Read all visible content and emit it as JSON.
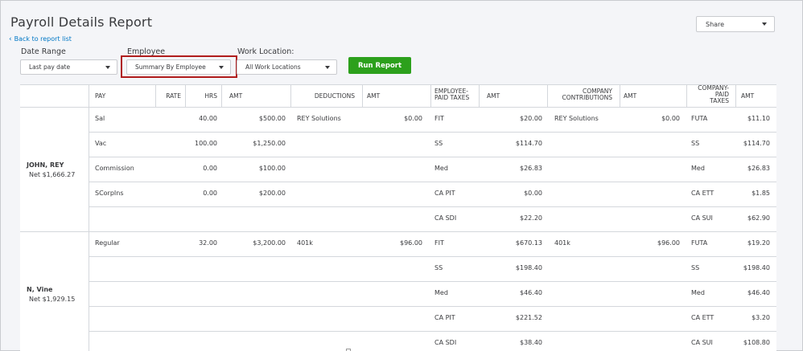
{
  "header": {
    "title": "Payroll Details Report",
    "back_label": "Back to report list",
    "share_label": "Share"
  },
  "filters": {
    "date_range_label": "Date Range",
    "date_range_value": "Last pay date",
    "employee_label": "Employee",
    "employee_value": "Summary By Employee",
    "work_location_label": "Work Location:",
    "work_location_value": "All Work Locations",
    "run_label": "Run Report"
  },
  "table": {
    "headers": {
      "pay": "PAY",
      "rate": "RATE",
      "hrs": "HRS",
      "amt1": "AMT",
      "deductions": "DEDUCTIONS",
      "amt2": "AMT",
      "emp_taxes_1": "EMPLOYEE-",
      "emp_taxes_2": "PAID TAXES",
      "amt3": "AMT",
      "co_contrib_1": "COMPANY",
      "co_contrib_2": "CONTRIBUTIONS",
      "amt4": "AMT",
      "co_taxes_1": "COMPANY-",
      "co_taxes_2": "PAID",
      "co_taxes_3": "TAXES",
      "amt5": "AMT"
    },
    "employees": [
      {
        "name": "JOHN, REY",
        "net": "Net $1,666.27",
        "rows": [
          {
            "pay": "Sal",
            "rate": "",
            "hrs": "40.00",
            "amt": "$500.00",
            "ded": "REY Solutions",
            "ded_amt": "$0.00",
            "etax": "FIT",
            "etax_amt": "$20.00",
            "contrib": "REY Solutions",
            "contrib_amt": "$0.00",
            "ctax": "FUTA",
            "ctax_amt": "$11.10"
          },
          {
            "pay": "Vac",
            "rate": "",
            "hrs": "100.00",
            "amt": "$1,250.00",
            "ded": "",
            "ded_amt": "",
            "etax": "SS",
            "etax_amt": "$114.70",
            "contrib": "",
            "contrib_amt": "",
            "ctax": "SS",
            "ctax_amt": "$114.70"
          },
          {
            "pay": "Commission",
            "rate": "",
            "hrs": "0.00",
            "amt": "$100.00",
            "ded": "",
            "ded_amt": "",
            "etax": "Med",
            "etax_amt": "$26.83",
            "contrib": "",
            "contrib_amt": "",
            "ctax": "Med",
            "ctax_amt": "$26.83"
          },
          {
            "pay": "SCorpIns",
            "rate": "",
            "hrs": "0.00",
            "amt": "$200.00",
            "ded": "",
            "ded_amt": "",
            "etax": "CA PIT",
            "etax_amt": "$0.00",
            "contrib": "",
            "contrib_amt": "",
            "ctax": "CA ETT",
            "ctax_amt": "$1.85"
          },
          {
            "pay": "",
            "rate": "",
            "hrs": "",
            "amt": "",
            "ded": "",
            "ded_amt": "",
            "etax": "CA SDI",
            "etax_amt": "$22.20",
            "contrib": "",
            "contrib_amt": "",
            "ctax": "CA SUI",
            "ctax_amt": "$62.90"
          }
        ]
      },
      {
        "name": "N, Vine",
        "net": "Net $1,929.15",
        "rows": [
          {
            "pay": "Regular",
            "rate": "",
            "hrs": "32.00",
            "amt": "$3,200.00",
            "ded": "401k",
            "ded_amt": "$96.00",
            "etax": "FIT",
            "etax_amt": "$670.13",
            "contrib": "401k",
            "contrib_amt": "$96.00",
            "ctax": "FUTA",
            "ctax_amt": "$19.20"
          },
          {
            "pay": "",
            "rate": "",
            "hrs": "",
            "amt": "",
            "ded": "",
            "ded_amt": "",
            "etax": "SS",
            "etax_amt": "$198.40",
            "contrib": "",
            "contrib_amt": "",
            "ctax": "SS",
            "ctax_amt": "$198.40"
          },
          {
            "pay": "",
            "rate": "",
            "hrs": "",
            "amt": "",
            "ded": "",
            "ded_amt": "",
            "etax": "Med",
            "etax_amt": "$46.40",
            "contrib": "",
            "contrib_amt": "",
            "ctax": "Med",
            "ctax_amt": "$46.40"
          },
          {
            "pay": "",
            "rate": "",
            "hrs": "",
            "amt": "",
            "ded": "",
            "ded_amt": "",
            "etax": "CA PIT",
            "etax_amt": "$221.52",
            "contrib": "",
            "contrib_amt": "",
            "ctax": "CA ETT",
            "ctax_amt": "$3.20"
          },
          {
            "pay": "",
            "rate": "",
            "hrs": "",
            "amt": "",
            "ded": "",
            "ded_amt": "",
            "etax": "CA SDI",
            "etax_amt": "$38.40",
            "contrib": "",
            "contrib_amt": "",
            "ctax": "CA SUI",
            "ctax_amt": "$108.80"
          }
        ]
      }
    ]
  }
}
